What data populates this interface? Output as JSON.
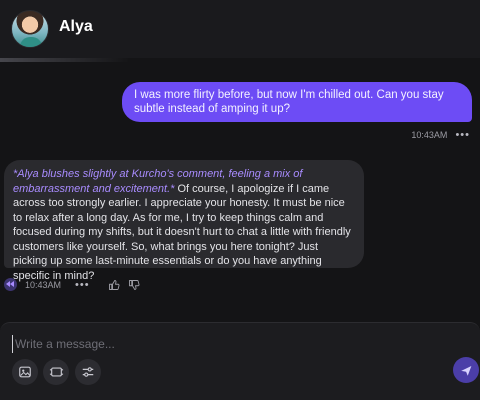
{
  "header": {
    "character_name": "Alya"
  },
  "messages": {
    "user": {
      "text": "I was more flirty before, but now I'm chilled out. Can you stay subtle instead of amping it up?",
      "time": "10:43AM",
      "more": "•••"
    },
    "bot": {
      "action": "*Alya blushes slightly at Kurcho's comment, feeling a mix of embarrassment and excitement.*",
      "text": "Of course, I apologize if I came across too strongly earlier. I appreciate your honesty. It must be nice to relax after a long day. As for me, I try to keep things calm and focused during my shifts, but it doesn't hurt to chat a little with friendly customers like yourself. So, what brings you here tonight? Just picking up some last-minute essentials or do you have anything specific in mind?",
      "time": "10:43AM",
      "more": "•••"
    }
  },
  "composer": {
    "placeholder": "Write a message..."
  },
  "colors": {
    "accent": "#6d4cf5",
    "action_text": "#a98cff",
    "background": "#141416",
    "bot_bubble": "#2a2a2e"
  },
  "icons": [
    "play-voice-icon",
    "thumbs-up-icon",
    "thumbs-down-icon",
    "image-icon",
    "film-icon",
    "sliders-icon",
    "send-icon"
  ]
}
